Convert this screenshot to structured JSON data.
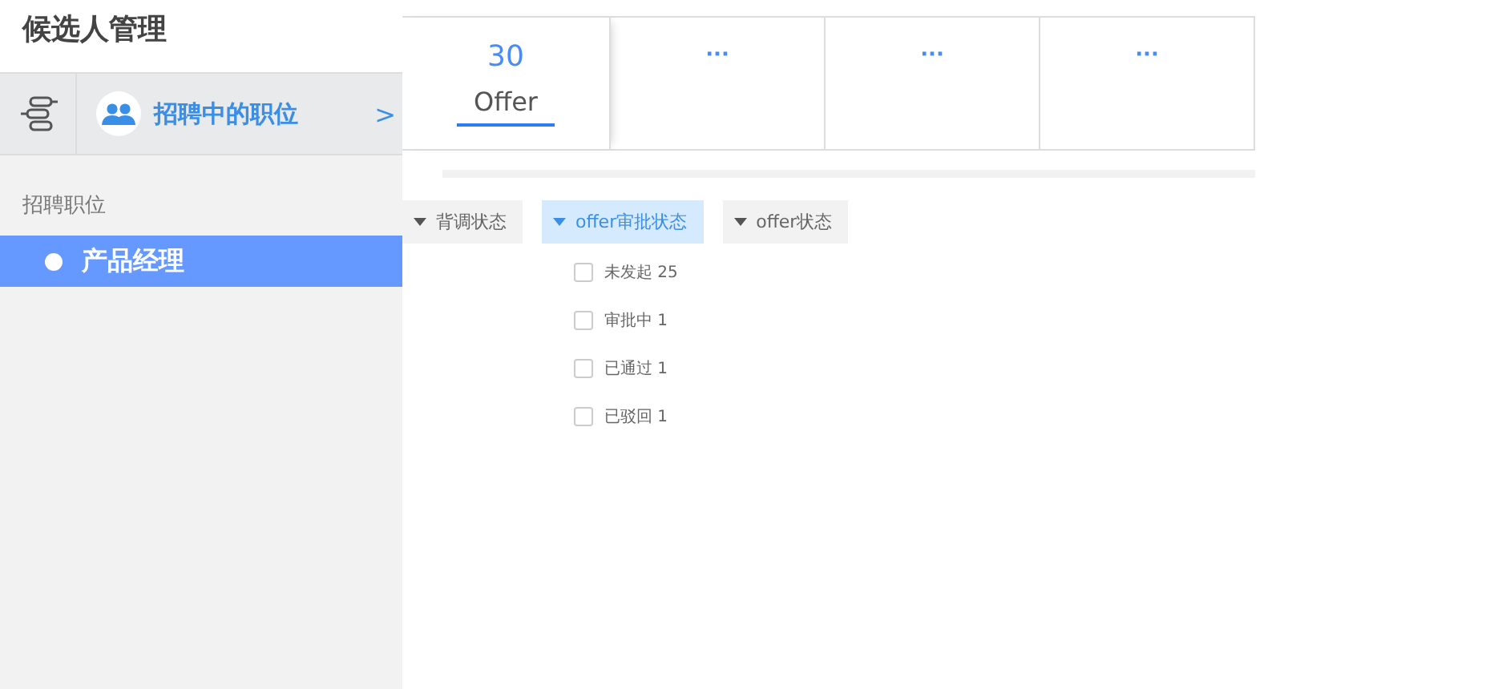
{
  "sidebar": {
    "title": "候选人管理",
    "switcher": {
      "label": "招聘中的职位",
      "arrow": ">"
    },
    "section": "招聘职位",
    "items": [
      {
        "label": "产品经理",
        "selected": true
      }
    ]
  },
  "stages": [
    {
      "count": "30",
      "label": "Offer",
      "selected": true
    },
    {
      "count": "···",
      "selected": false
    },
    {
      "count": "···",
      "selected": false
    },
    {
      "count": "···",
      "selected": false
    }
  ],
  "filters": [
    {
      "label": "背调状态",
      "selected": false
    },
    {
      "label": "offer审批状态",
      "selected": true
    },
    {
      "label": "offer状态",
      "selected": false
    }
  ],
  "options": [
    {
      "label": "未发起 25",
      "checked": false
    },
    {
      "label": "审批中 1",
      "checked": false
    },
    {
      "label": "已通过 1",
      "checked": false
    },
    {
      "label": "已驳回 1",
      "checked": false
    }
  ]
}
